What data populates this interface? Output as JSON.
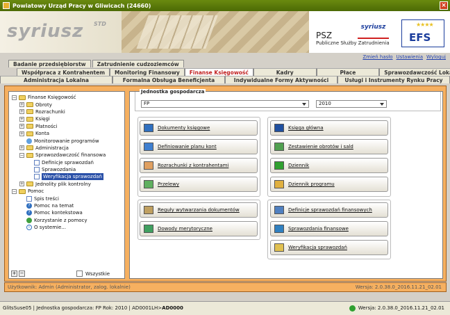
{
  "window": {
    "title": "Powiatowy Urząd Pracy w Gliwicach (24660)",
    "close": "×"
  },
  "banner": {
    "logo": "syriusz",
    "logo_suffix": "STD",
    "psz_title": "PSZ",
    "psz_subtitle": "Publiczne Służby Zatrudnienia",
    "psz_logo": "syriusz",
    "efs": "EFS",
    "efs_stars": "★★★★"
  },
  "header_links": [
    "Zmień hasło",
    "Ustawienia",
    "Wyloguj"
  ],
  "tabs": {
    "row1": [
      "Badanie przedsiębiorstw",
      "Zatrudnienie cudzoziemców"
    ],
    "row2": [
      "Współpraca z Kontrahentem",
      "Monitoring Finansowy",
      "Finanse Księgowość",
      "Kadry",
      "Płace",
      "Sprawozdawczość Lokalna"
    ],
    "row3": [
      "Administracja Lokalna",
      "Formalna Obsługa Beneficjenta",
      "Indywidualne Formy Aktywności",
      "Usługi i Instrumenty Rynku Pracy"
    ],
    "active": "Finanse Księgowość"
  },
  "tree": [
    {
      "label": "Finanse Księgowość",
      "level": 0,
      "exp": "−",
      "icon": "folder"
    },
    {
      "label": "Obroty",
      "level": 1,
      "exp": "+",
      "icon": "folder"
    },
    {
      "label": "Rozrachunki",
      "level": 1,
      "exp": "+",
      "icon": "folder"
    },
    {
      "label": "Księgi",
      "level": 1,
      "exp": "+",
      "icon": "folder"
    },
    {
      "label": "Płatności",
      "level": 1,
      "exp": "+",
      "icon": "folder"
    },
    {
      "label": "Konta",
      "level": 1,
      "exp": "+",
      "icon": "folder"
    },
    {
      "label": "Monitorowanie programów",
      "level": 1,
      "exp": "",
      "icon": "gear"
    },
    {
      "label": "Administracja",
      "level": 1,
      "exp": "+",
      "icon": "folder"
    },
    {
      "label": "Sprawozdawczość finansowa",
      "level": 1,
      "exp": "−",
      "icon": "folder"
    },
    {
      "label": "Definicje sprawozdań",
      "level": 2,
      "exp": "",
      "icon": "doc"
    },
    {
      "label": "Sprawozdania",
      "level": 2,
      "exp": "",
      "icon": "doc"
    },
    {
      "label": "Weryfikacja sprawozdań",
      "level": 2,
      "exp": "",
      "icon": "doc",
      "selected": true
    },
    {
      "label": "Jednolity plik kontrolny",
      "level": 1,
      "exp": "+",
      "icon": "folder"
    },
    {
      "label": "Pomoc",
      "level": 0,
      "exp": "−",
      "icon": "folder"
    },
    {
      "label": "Spis treści",
      "level": 1,
      "exp": "",
      "icon": "doc"
    },
    {
      "label": "Pomoc na temat",
      "level": 1,
      "exp": "",
      "icon": "help"
    },
    {
      "label": "Pomoc kontekstowa",
      "level": 1,
      "exp": "",
      "icon": "help"
    },
    {
      "label": "Korzystanie z pomocy",
      "level": 1,
      "exp": "",
      "icon": "okicon"
    },
    {
      "label": "O systemie...",
      "level": 1,
      "exp": "",
      "icon": "info"
    }
  ],
  "tree_controls": {
    "expand": "+",
    "collapse": "−",
    "all_label": "Wszystkie"
  },
  "jg": {
    "label": "Jednostka gospodarcza",
    "unit": "FP",
    "year": "2010"
  },
  "buttons_left": [
    "Dokumenty księgowe",
    "Definiowanie planu kont",
    "Rozrachunki z kontrahentami",
    "Przelewy"
  ],
  "buttons_right": [
    "Księga główna",
    "Zestawienie obrotów i sald",
    "Dziennik",
    "Dziennik programu"
  ],
  "buttons_left2": [
    "Reguły wytwarzania dokumentów",
    "Dowody merytoryczne"
  ],
  "buttons_right2": [
    "Definicje sprawozdań finansowych",
    "Sprawozdania finansowe",
    "Weryfikacja sprawozdań"
  ],
  "user_bar": {
    "user": "Użytkownik: Admin (Administrator, zalog. lokalnie)",
    "version": "Wersja: 2.0.38.0_2016.11.21_02.01"
  },
  "status_bar": {
    "left_prefix": "GlitsSuse05 | Jednostka gospodarcza: FP Rok: 2010 | AD0001LH>",
    "left_bold": "AD0000",
    "version": "Wersja: 2.0.38.0_2016.11.21_02.01"
  },
  "colors": {
    "frame": "#f6b060",
    "active_tab": "#c02020",
    "title_bar": "#5a7a0a",
    "selection": "#2a50a8"
  }
}
